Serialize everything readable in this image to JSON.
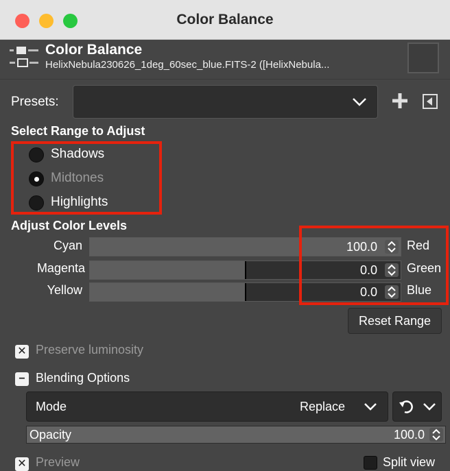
{
  "window": {
    "title": "Color Balance"
  },
  "header": {
    "title": "Color Balance",
    "subtitle": "HelixNebula230626_1deg_60sec_blue.FITS-2 ([HelixNebula..."
  },
  "presets": {
    "label": "Presets:",
    "value": ""
  },
  "range": {
    "title": "Select Range to Adjust",
    "options": [
      {
        "label": "Shadows",
        "selected": false
      },
      {
        "label": "Midtones",
        "selected": true
      },
      {
        "label": "Highlights",
        "selected": false
      }
    ]
  },
  "levels": {
    "title": "Adjust Color Levels",
    "rows": [
      {
        "left": "Cyan",
        "right": "Red",
        "value": "100.0",
        "level": 100.0,
        "min": -100,
        "max": 100
      },
      {
        "left": "Magenta",
        "right": "Green",
        "value": "0.0",
        "level": 0.0,
        "min": -100,
        "max": 100
      },
      {
        "left": "Yellow",
        "right": "Blue",
        "value": "0.0",
        "level": 0.0,
        "min": -100,
        "max": 100
      }
    ],
    "reset_label": "Reset Range"
  },
  "preserve_luminosity": {
    "label": "Preserve luminosity",
    "checked": true
  },
  "blending": {
    "label": "Blending Options",
    "expanded": true,
    "mode_label": "Mode",
    "mode_value": "Replace",
    "opacity_label": "Opacity",
    "opacity_value": "100.0",
    "opacity_level": 100.0
  },
  "preview": {
    "label": "Preview",
    "checked": true
  },
  "split_view": {
    "label": "Split view",
    "checked": false
  },
  "colors": {
    "highlight": "#e5220d",
    "panel": "#454545",
    "field": "#2e2e2e"
  }
}
